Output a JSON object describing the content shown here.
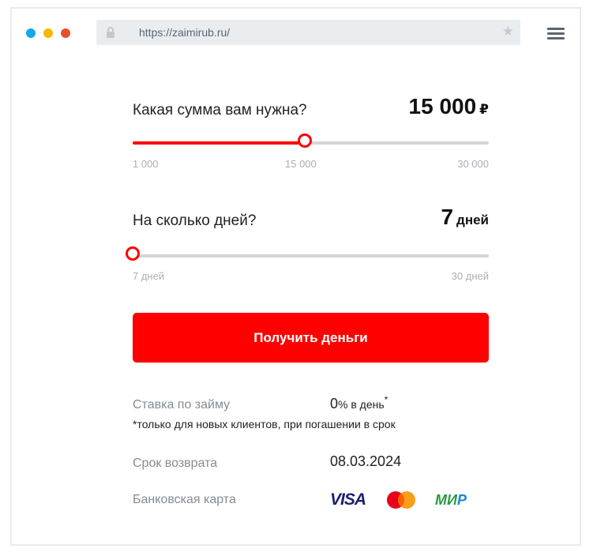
{
  "browser": {
    "url": "https://zaimirub.ru/",
    "dot_colors": [
      "#11a8f0",
      "#f5b800",
      "#e8502c"
    ]
  },
  "amount": {
    "question": "Какая сумма вам нужна?",
    "value": "15 000",
    "currency": "₽",
    "min_label": "1 000",
    "mid_label": "15 000",
    "max_label": "30 000",
    "min": 1000,
    "max": 30000,
    "current": 15000
  },
  "days": {
    "question": "На сколько дней?",
    "value": "7",
    "unit": "дней",
    "min_label": "7 дней",
    "max_label": "30 дней",
    "min": 7,
    "max": 30,
    "current": 7
  },
  "cta": {
    "label": "Получить деньги"
  },
  "rate": {
    "label": "Ставка по займу",
    "value": "0",
    "suffix": "% в день",
    "asterisk": "*",
    "note": "*только для новых клиентов, при погашении в срок"
  },
  "return": {
    "label": "Срок возврата",
    "date": "08.03.2024"
  },
  "card": {
    "label": "Банковская карта",
    "visa": "VISA",
    "mir_a": "МИ",
    "mir_b": "Р"
  },
  "colors": {
    "accent": "#ff0000",
    "track": "#d3d5d8"
  },
  "icons": [
    "lock-icon",
    "star-icon",
    "hamburger-menu-icon",
    "visa-logo",
    "mastercard-logo",
    "mir-logo"
  ]
}
